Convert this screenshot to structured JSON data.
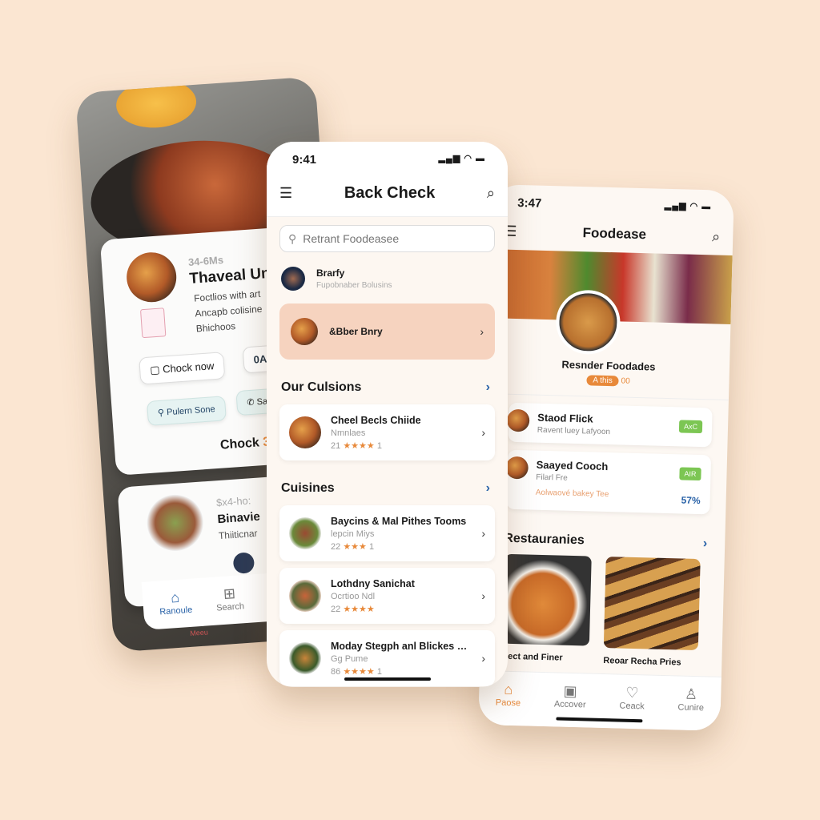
{
  "colors": {
    "background": "#fbe6d2",
    "accent": "#e8893a",
    "highlight": "#f6d3bf",
    "link": "#2a63a8",
    "badge": "#7cc653"
  },
  "left": {
    "card1": {
      "time": "34-6Ms",
      "title": "Thaveal Uni",
      "lines": [
        "Foctlios with art",
        "Ancapb colisine",
        "Bhichoos"
      ],
      "btn1": "Chock now",
      "btn2": "0A",
      "btn3": "Pulern Sone",
      "btn4": "Salo",
      "cta": "Chock",
      "cta_accent": "31"
    },
    "card2": {
      "time": "$x4-ho:",
      "title": "Binavie",
      "sub": "Thiiticnar"
    },
    "tabs": [
      {
        "label": "Ranoule",
        "icon": "home-icon"
      },
      {
        "label": "Search",
        "icon": "search-grid-icon"
      }
    ],
    "under": "Meeu"
  },
  "mid": {
    "time": "9:41",
    "title": "Back Check",
    "search_placeholder": "Retrant Foodeasee",
    "profile": {
      "name": "Brarfy",
      "sub": "Fupobnaber Bolusins"
    },
    "featured": "&Bber Bnry",
    "section1": "Our Culsions",
    "list1": [
      {
        "title": "Cheel Becls Chiide",
        "sub": "Nmnlaes",
        "count": "21",
        "stars": "★★★★",
        "suffix": "1"
      }
    ],
    "section2": "Cuisines",
    "list2": [
      {
        "title": "Baycins & Mal Pithes Tooms",
        "sub": "lepcin Miys",
        "count": "22",
        "stars": "★★★",
        "suffix": "1"
      },
      {
        "title": "Lothdny Sanichat",
        "sub": "Ocrtioo Ndl",
        "count": "22",
        "stars": "★★★★",
        "suffix": ""
      },
      {
        "title": "Moday Stegph anl Blickes Ron..",
        "sub": "Gg Pume",
        "count": "86",
        "stars": "★★★★",
        "suffix": "1"
      }
    ]
  },
  "right": {
    "time": "3:47",
    "title": "Foodease",
    "hero_name": "Resnder Foodades",
    "hero_tag": "A this",
    "hero_count": "00",
    "cards": [
      {
        "title": "Staod Flick",
        "sub": "Ravent luey Lafyoon",
        "badge": "AxC"
      },
      {
        "title": "Saayed Cooch",
        "sub": "Filarl Fre",
        "badge": "AIR",
        "extra": "Aolwaové bakey Tee",
        "percent": "57%"
      }
    ],
    "section": "Restauranies",
    "tiles": [
      {
        "name": "Lect and Finer"
      },
      {
        "name": "Reoar Recha Pries"
      }
    ],
    "tabs": [
      {
        "label": "Paose",
        "icon": "home-icon",
        "active": true
      },
      {
        "label": "Accover",
        "icon": "discover-icon"
      },
      {
        "label": "Ceack",
        "icon": "heart-icon"
      },
      {
        "label": "Cunire",
        "icon": "profile-icon"
      }
    ]
  }
}
